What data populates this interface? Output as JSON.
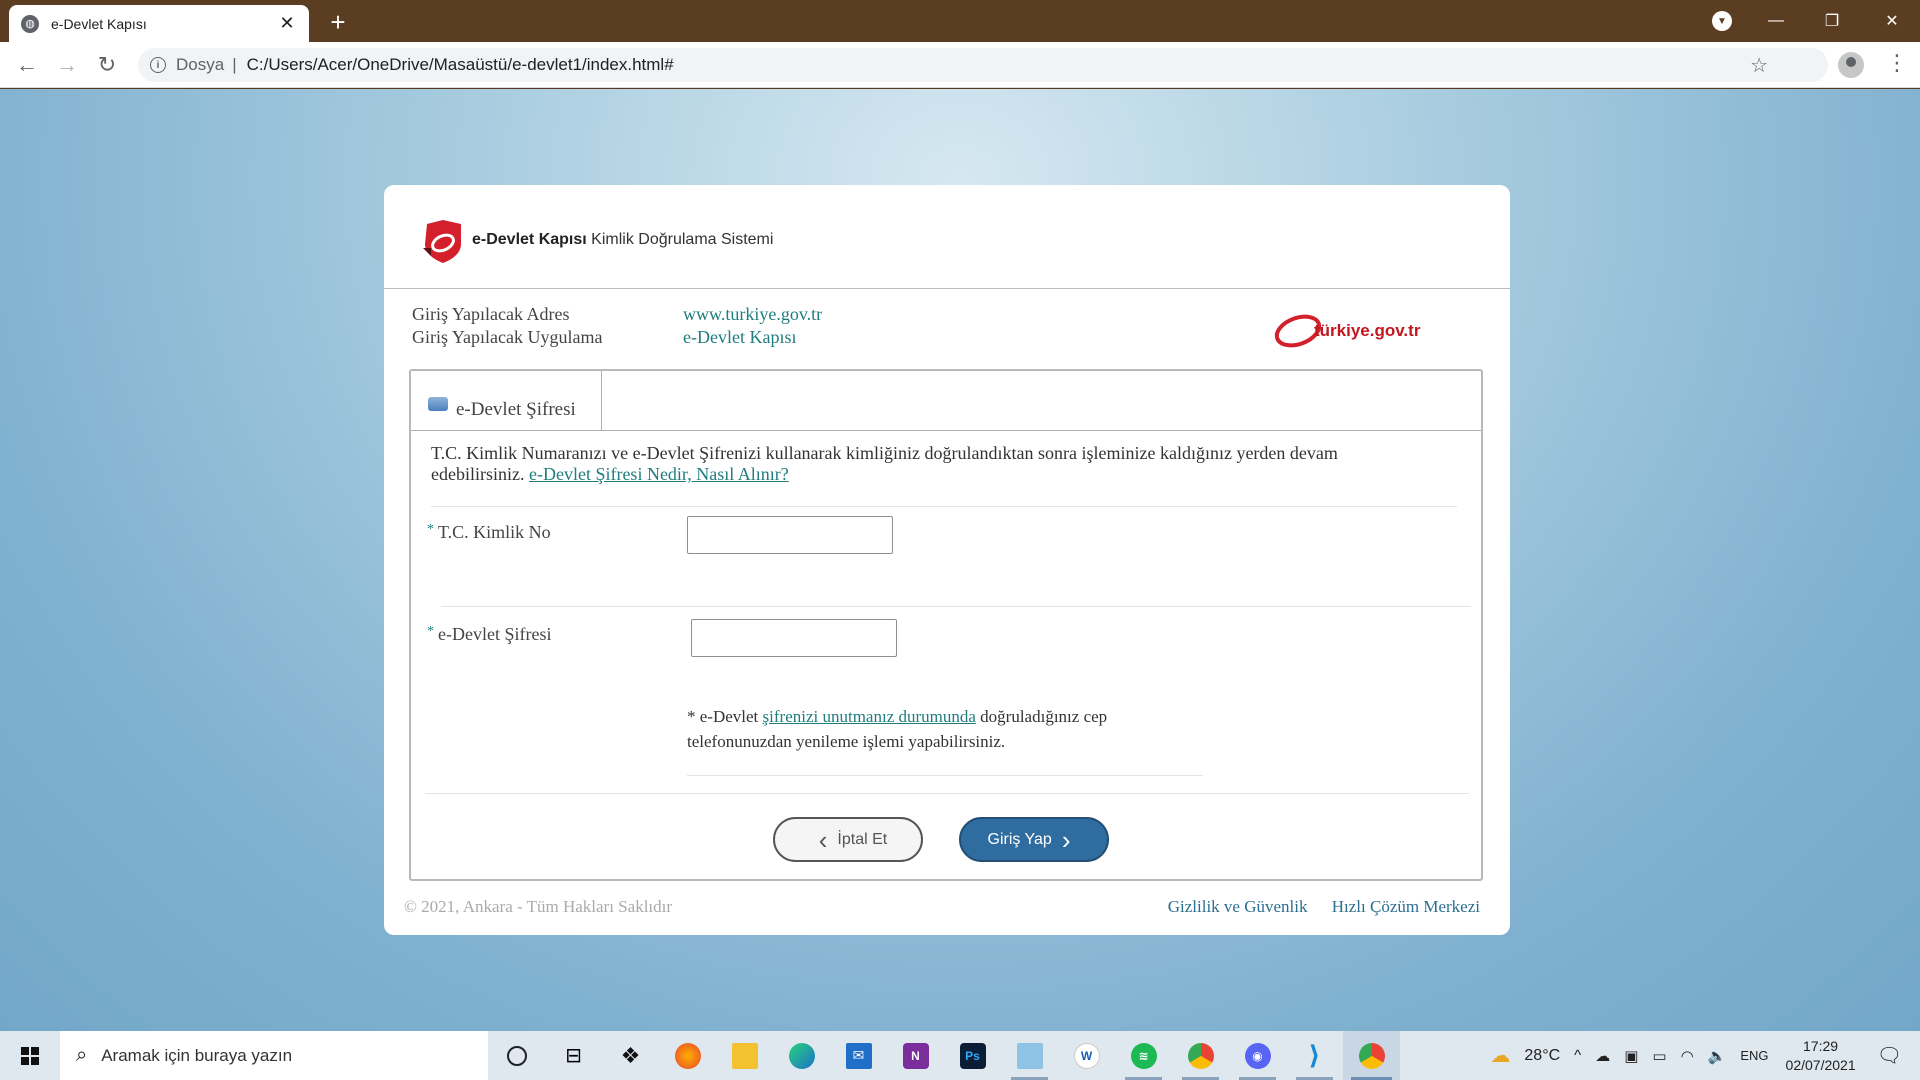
{
  "browser": {
    "tab_title": "e-Devlet Kapısı",
    "scheme_label": "Dosya",
    "url": "C:/Users/Acer/OneDrive/Masaüstü/e-devlet1/index.html#"
  },
  "header": {
    "brand_bold": "e-Devlet Kapısı",
    "brand_rest": "Kimlik Doğrulama Sistemi"
  },
  "info": {
    "address_label": "Giriş Yapılacak Adres",
    "address_value": "www.turkiye.gov.tr",
    "app_label": "Giriş Yapılacak Uygulama",
    "app_value": "e-Devlet Kapısı",
    "logo_text": "türkiye.gov.tr"
  },
  "panel": {
    "tab_label": "e-Devlet Şifresi",
    "description": "T.C. Kimlik Numaranızı ve e-Devlet Şifrenizi kullanarak kimliğiniz doğrulandıktan sonra işleminize kaldığınız yerden devam edebilirsiniz.",
    "description_link": "e-Devlet Şifresi Nedir, Nasıl Alınır?",
    "required_mark": "*",
    "tc_label": "T.C. Kimlik No",
    "tc_value": "",
    "password_label": "e-Devlet Şifresi",
    "password_value": "",
    "note_prefix": "* e-Devlet",
    "note_link": "şifrenizi unutmanız durumunda",
    "note_suffix": "doğruladığınız cep telefonunuzdan yenileme işlemi yapabilirsiniz.",
    "cancel_label": "İptal Et",
    "login_label": "Giriş Yap"
  },
  "footer": {
    "copyright": "© 2021, Ankara - Tüm Hakları Saklıdır",
    "privacy": "Gizlilik ve Güvenlik",
    "help": "Hızlı Çözüm Merkezi"
  },
  "taskbar": {
    "search_placeholder": "Aramak için buraya yazın",
    "weather": "28°C",
    "language": "ENG",
    "time": "17:29",
    "date": "02/07/2021"
  },
  "colors": {
    "accent_teal": "#1f7d7e",
    "brand_red": "#d3202a",
    "login_blue": "#2f6da0"
  }
}
